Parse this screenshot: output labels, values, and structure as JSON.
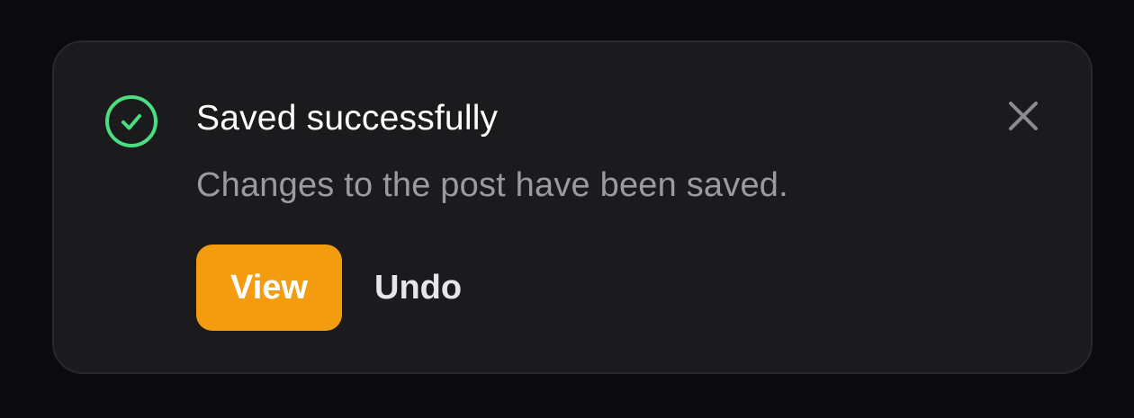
{
  "toast": {
    "title": "Saved successfully",
    "message": "Changes to the post have been saved.",
    "status_icon": "check-circle-icon",
    "close_icon": "close-icon",
    "actions": {
      "view_label": "View",
      "undo_label": "Undo"
    }
  },
  "colors": {
    "page_bg": "#0b0b0d",
    "toast_bg": "#1b1b1d",
    "success": "#4ade80",
    "accent": "#f39c0f",
    "title": "#ffffff",
    "message": "#9a9aa2",
    "close": "#8a8a92"
  }
}
